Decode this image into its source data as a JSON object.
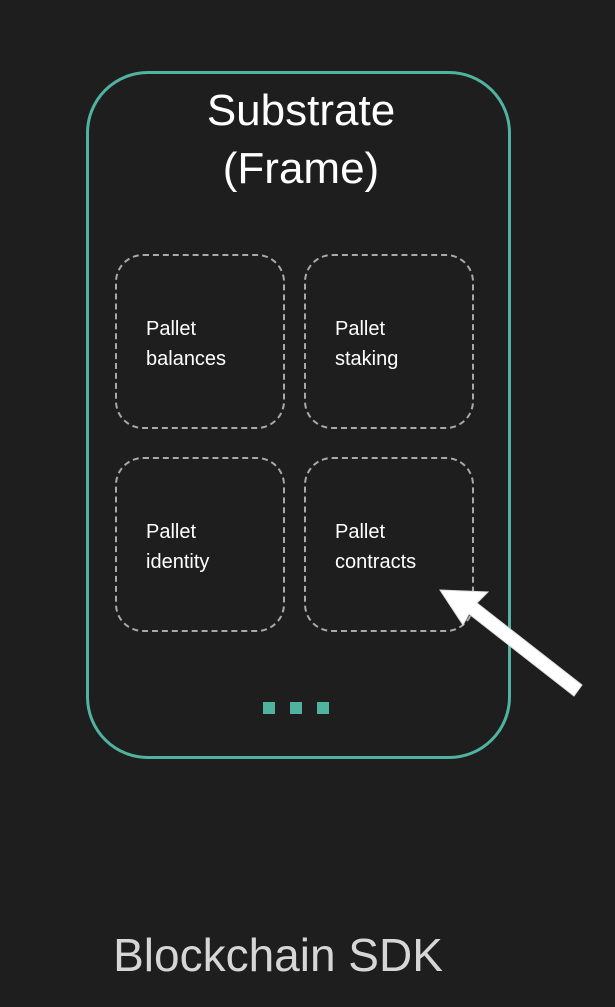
{
  "diagram": {
    "title_line1": "Substrate",
    "title_line2": "(Frame)",
    "pallets": [
      {
        "line1": "Pallet",
        "line2": "balances"
      },
      {
        "line1": "Pallet",
        "line2": "staking"
      },
      {
        "line1": "Pallet",
        "line2": "identity"
      },
      {
        "line1": "Pallet",
        "line2": "contracts"
      }
    ],
    "more_indicator": "...",
    "footer": "Blockchain SDK"
  },
  "colors": {
    "background": "#1e1e1e",
    "accent": "#4fb3a0",
    "dashed_border": "#a9a9a9",
    "text": "#ffffff",
    "footer_text": "#d6d6d6"
  }
}
